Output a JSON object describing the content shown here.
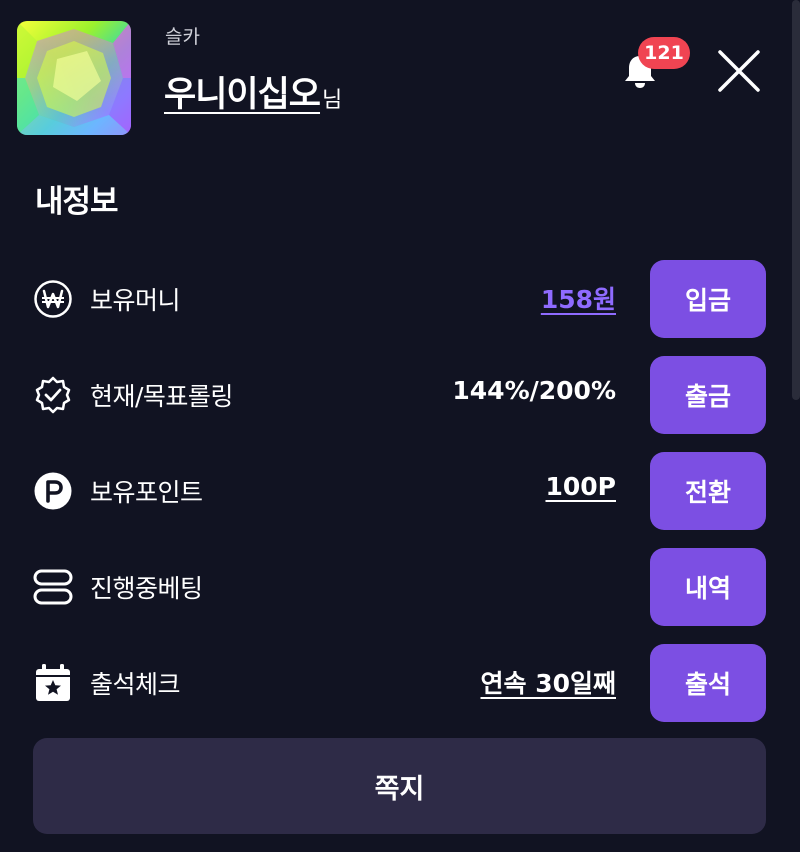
{
  "header": {
    "grade": "슬카",
    "username": "우니이십오",
    "username_suffix": "님",
    "notification_count": "121"
  },
  "section_title": "내정보",
  "rows": [
    {
      "icon": "won-circle-icon",
      "label": "보유머니",
      "value": "158원",
      "button": "입금"
    },
    {
      "icon": "verified-badge-icon",
      "label": "현재/목표롤링",
      "value": "144%/200%",
      "button": "출금"
    },
    {
      "icon": "point-circle-icon",
      "label": "보유포인트",
      "value": "100P",
      "button": "전환"
    },
    {
      "icon": "server-list-icon",
      "label": "진행중베팅",
      "value": "",
      "button": "내역"
    },
    {
      "icon": "calendar-star-icon",
      "label": "출석체크",
      "value": "연속 30일째",
      "button": "출석"
    }
  ],
  "message_button": "쪽지",
  "colors": {
    "background": "#111322",
    "accent": "#7c4fe3",
    "link_purple": "#8f6bff",
    "badge": "#f04452",
    "message_button": "#2e2b47"
  }
}
